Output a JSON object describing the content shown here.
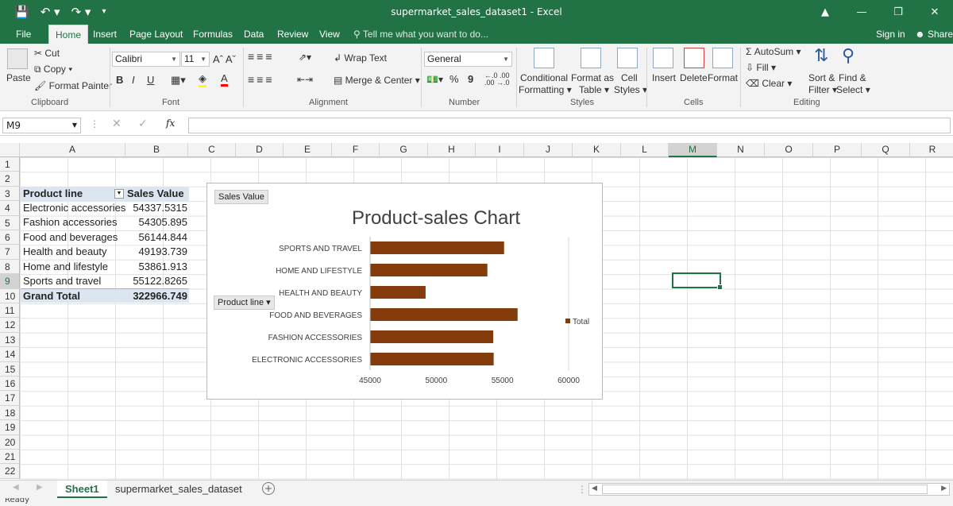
{
  "window": {
    "title": "supermarket_sales_dataset1 - Excel"
  },
  "tabs": [
    "File",
    "Home",
    "Insert",
    "Page Layout",
    "Formulas",
    "Data",
    "Review",
    "View"
  ],
  "tell_me": "Tell me what you want to do...",
  "account": {
    "sign_in": "Sign in",
    "share": "Share"
  },
  "ribbon": {
    "clipboard": {
      "paste": "Paste",
      "cut": "Cut",
      "copy": "Copy",
      "format_painter": "Format Painter",
      "label": "Clipboard"
    },
    "font": {
      "name": "Calibri",
      "size": "11",
      "bold": "B",
      "italic": "I",
      "underline": "U",
      "label": "Font"
    },
    "alignment": {
      "wrap": "Wrap Text",
      "merge": "Merge & Center",
      "label": "Alignment"
    },
    "number": {
      "format": "General",
      "percent": "%",
      "comma": "9",
      "label": "Number"
    },
    "styles": {
      "conditional": "Conditional",
      "formatting": "Formatting",
      "format_as": "Format as",
      "table": "Table",
      "cell": "Cell",
      "cell_styles": "Styles",
      "label": "Styles"
    },
    "cells": {
      "insert": "Insert",
      "delete": "Delete",
      "format": "Format",
      "label": "Cells"
    },
    "editing": {
      "autosum": "AutoSum",
      "fill": "Fill",
      "clear": "Clear",
      "sort": "Sort &",
      "filter": "Filter",
      "find": "Find &",
      "select": "Select",
      "label": "Editing"
    }
  },
  "formula_bar": {
    "name_box": "M9",
    "fx": "fx",
    "value": ""
  },
  "columns": [
    "A",
    "B",
    "C",
    "D",
    "E",
    "F",
    "G",
    "H",
    "I",
    "J",
    "K",
    "L",
    "M",
    "N",
    "O",
    "P",
    "Q",
    "R"
  ],
  "rows": [
    "1",
    "2",
    "3",
    "4",
    "5",
    "6",
    "7",
    "8",
    "9",
    "10",
    "11",
    "12",
    "13",
    "14",
    "15",
    "16",
    "17",
    "18",
    "19",
    "20",
    "21",
    "22"
  ],
  "pivot": {
    "header": {
      "label": "Product line",
      "value": "Sales Value"
    },
    "rows": [
      {
        "label": "Electronic accessories",
        "value": "54337.5315"
      },
      {
        "label": "Fashion accessories",
        "value": "54305.895"
      },
      {
        "label": "Food and beverages",
        "value": "56144.844"
      },
      {
        "label": "Health and beauty",
        "value": "49193.739"
      },
      {
        "label": "Home and lifestyle",
        "value": "53861.913"
      },
      {
        "label": "Sports and travel",
        "value": "55122.8265"
      }
    ],
    "total": {
      "label": "Grand Total",
      "value": "322966.749"
    }
  },
  "chart_buttons": {
    "value_field": "Sales Value",
    "axis_field": "Product line"
  },
  "chart_data": {
    "type": "bar",
    "title": "Product-sales Chart",
    "categories": [
      "ELECTRONIC ACCESSORIES",
      "FASHION ACCESSORIES",
      "FOOD AND BEVERAGES",
      "HEALTH AND BEAUTY",
      "HOME AND LIFESTYLE",
      "SPORTS AND TRAVEL"
    ],
    "series": [
      {
        "name": "Total",
        "values": [
          54337.5315,
          54305.895,
          56144.844,
          49193.739,
          53861.913,
          55122.8265
        ],
        "color": "#843c0c"
      }
    ],
    "xlim": [
      45000,
      60000
    ],
    "xticks": [
      "45000",
      "50000",
      "55000",
      "60000"
    ],
    "orientation": "horizontal",
    "legend": "right"
  },
  "sheets": [
    "Sheet1",
    "supermarket_sales_dataset"
  ],
  "status": {
    "ready": "Ready"
  },
  "colors": {
    "excel_green": "#217346",
    "bar": "#843c0c",
    "pivot_header": "#dce6f1"
  }
}
